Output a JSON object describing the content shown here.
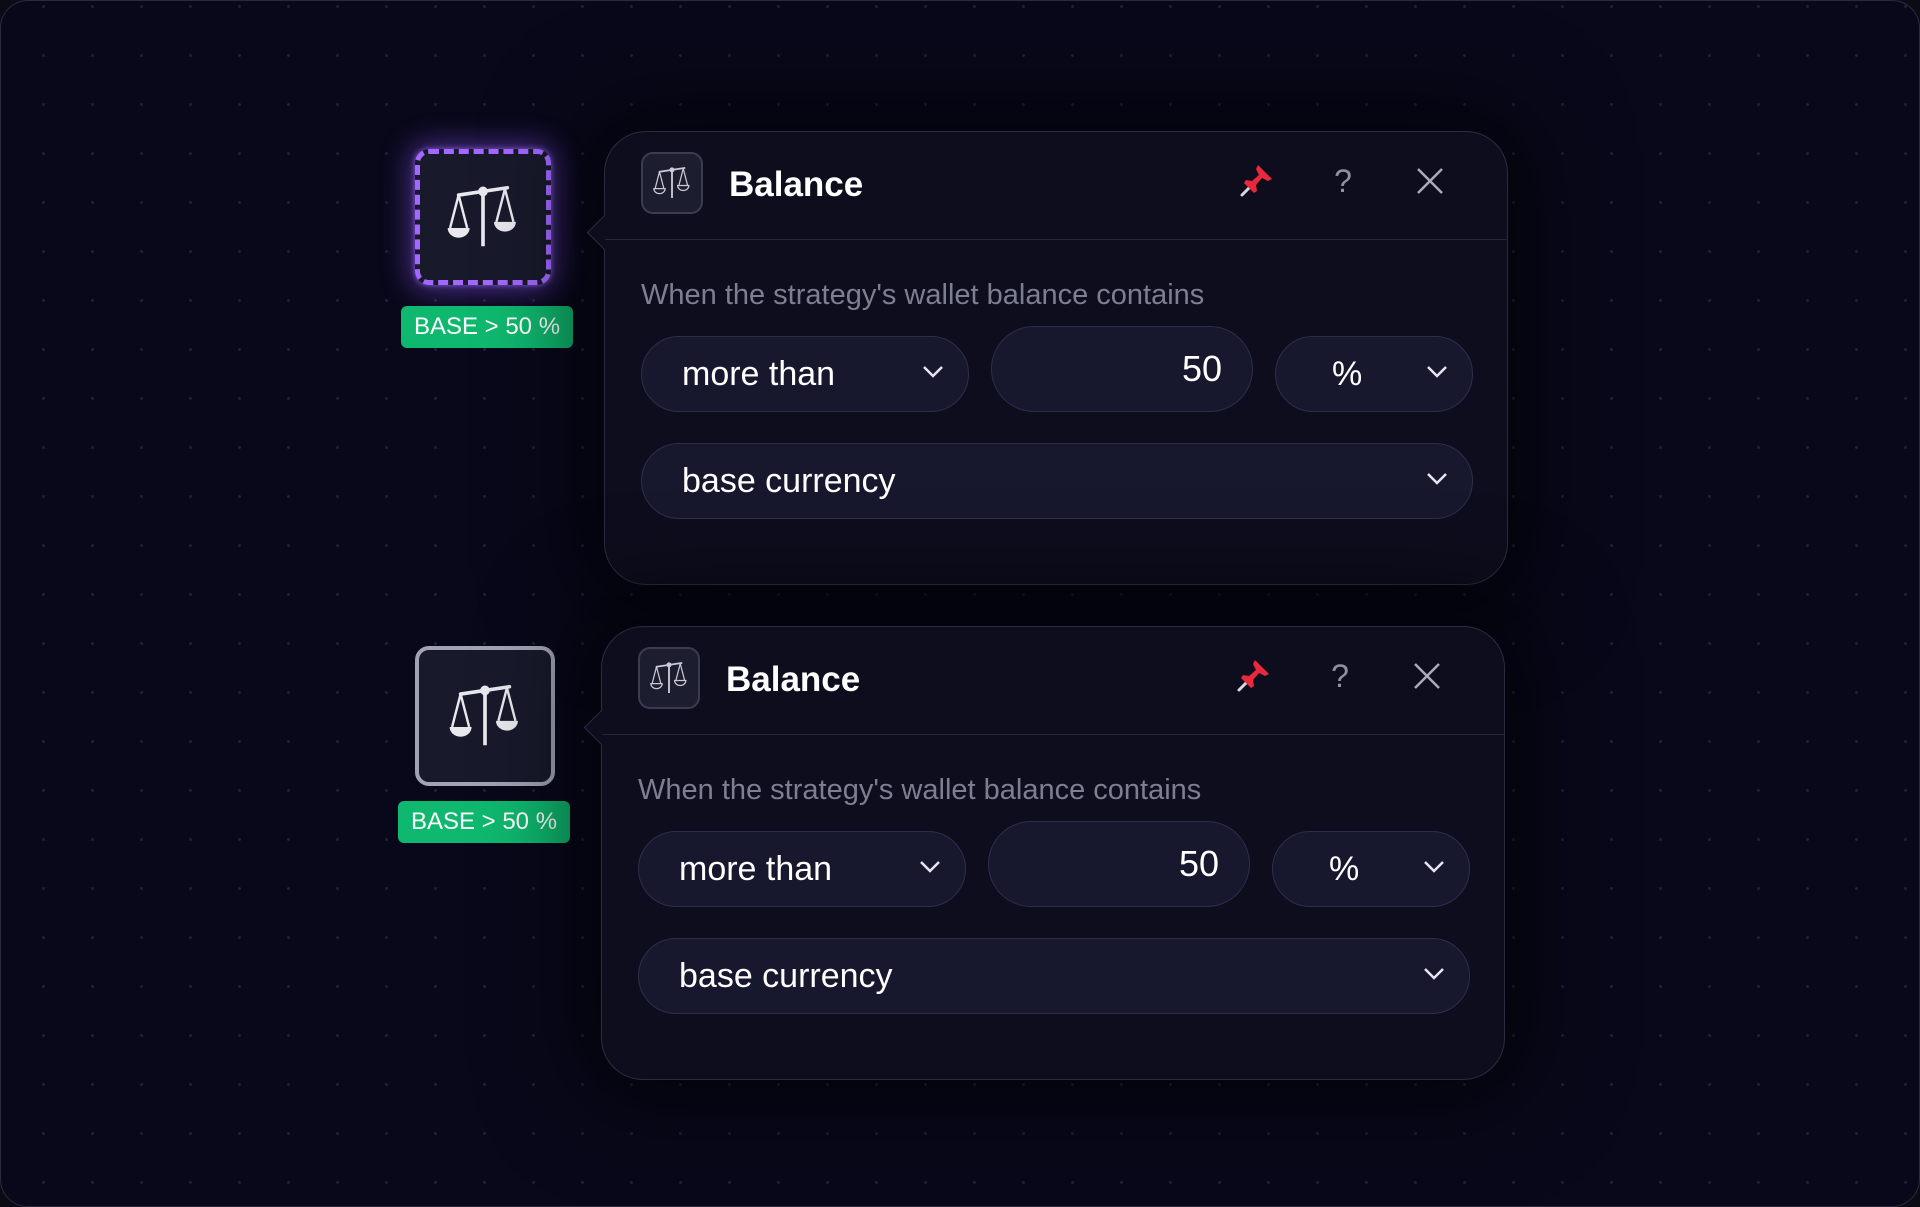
{
  "blocks": [
    {
      "selected": true,
      "badge": "BASE > 50 %",
      "title": "Balance",
      "description": "When the strategy's wallet balance contains",
      "operator": "more than",
      "value": "50",
      "unit": "%",
      "currency": "base currency",
      "help_label": "?"
    },
    {
      "selected": false,
      "badge": "BASE > 50 %",
      "title": "Balance",
      "description": "When the strategy's wallet balance contains",
      "operator": "more than",
      "value": "50",
      "unit": "%",
      "currency": "base currency",
      "help_label": "?"
    }
  ],
  "icons": {
    "node": "balance-scale-icon",
    "pin": "pin-icon",
    "help": "question-icon",
    "close": "close-icon",
    "dropdown": "chevron-down-icon"
  },
  "colors": {
    "accent_purple": "#a368ff",
    "badge_green": "#0fb86f",
    "pin_red": "#e8283b"
  }
}
